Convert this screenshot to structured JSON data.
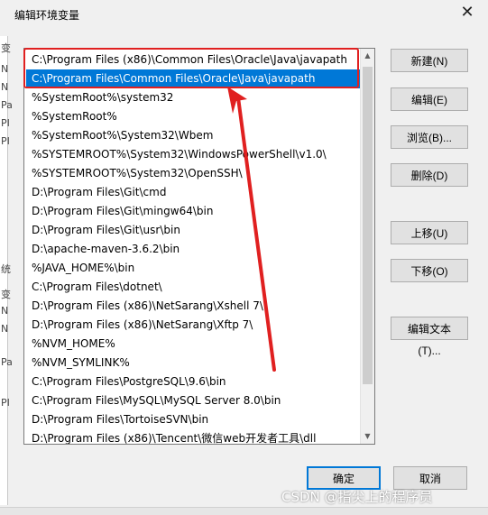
{
  "window": {
    "title": "编辑环境变量"
  },
  "background_labels": [
    "变",
    "N",
    "N",
    "Pa",
    "PI",
    "PI",
    "统",
    "变",
    "N",
    "N",
    "Pa",
    "PI"
  ],
  "paths": [
    "C:\\Program Files (x86)\\Common Files\\Oracle\\Java\\javapath",
    "C:\\Program Files\\Common Files\\Oracle\\Java\\javapath",
    "%SystemRoot%\\system32",
    "%SystemRoot%",
    "%SystemRoot%\\System32\\Wbem",
    "%SYSTEMROOT%\\System32\\WindowsPowerShell\\v1.0\\",
    "%SYSTEMROOT%\\System32\\OpenSSH\\",
    "D:\\Program Files\\Git\\cmd",
    "D:\\Program Files\\Git\\mingw64\\bin",
    "D:\\Program Files\\Git\\usr\\bin",
    "D:\\apache-maven-3.6.2\\bin",
    "%JAVA_HOME%\\bin",
    "C:\\Program Files\\dotnet\\",
    "D:\\Program Files (x86)\\NetSarang\\Xshell 7\\",
    "D:\\Program Files (x86)\\NetSarang\\Xftp 7\\",
    "%NVM_HOME%",
    "%NVM_SYMLINK%",
    "C:\\Program Files\\PostgreSQL\\9.6\\bin",
    "C:\\Program Files\\MySQL\\MySQL Server 8.0\\bin",
    "D:\\Program Files\\TortoiseSVN\\bin",
    "D:\\Program Files (x86)\\Tencent\\微信web开发者工具\\dll"
  ],
  "selected_index": 1,
  "buttons": {
    "new": "新建(N)",
    "edit": "编辑(E)",
    "browse": "浏览(B)...",
    "delete": "删除(D)",
    "move_up": "上移(U)",
    "move_down": "下移(O)",
    "edit_text": "编辑文本(T)...",
    "ok": "确定",
    "cancel": "取消"
  },
  "watermark": "CSDN @指尖上的程序员",
  "colors": {
    "selection": "#0078d7",
    "annotation": "#e02020"
  }
}
